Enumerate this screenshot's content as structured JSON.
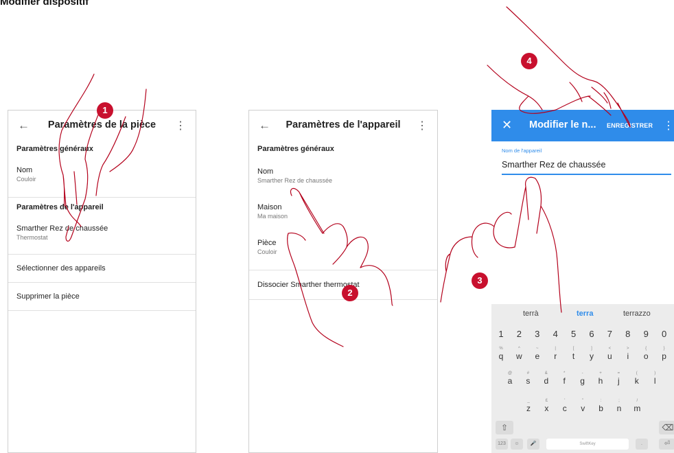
{
  "page": {
    "title": "Modifier dispositif"
  },
  "screen1": {
    "title": "Paramètres de la pièce",
    "back_icon": "←",
    "menu_icon": "⋮",
    "section_general": "Paramètres généraux",
    "name_label": "Nom",
    "name_value": "Couloir",
    "section_device": "Paramètres de l'appareil",
    "device_name": "Smarther Rez de chaussée",
    "device_type": "Thermostat",
    "select_devices": "Sélectionner des appareils",
    "delete_room": "Supprimer la pièce"
  },
  "screen2": {
    "title": "Paramètres de l'appareil",
    "back_icon": "←",
    "menu_icon": "⋮",
    "section_general": "Paramètres généraux",
    "name_label": "Nom",
    "name_value": "Smarther Rez de chaussée",
    "home_label": "Maison",
    "home_value": "Ma maison",
    "room_label": "Pièce",
    "room_value": "Couloir",
    "dissociate": "Dissocier Smarther thermostat"
  },
  "screen3": {
    "title": "Modifier le n...",
    "close_icon": "✕",
    "save": "ENREGISTRER",
    "menu_icon": "⋮",
    "field_label": "Nom de l'appareil",
    "field_value": "Smarther Rez de chaussée",
    "keyboard": {
      "suggestions": [
        "terrà",
        "terra",
        "terrazzo"
      ],
      "numbers": [
        "1",
        "2",
        "3",
        "4",
        "5",
        "6",
        "7",
        "8",
        "9",
        "0"
      ],
      "row1": [
        [
          "%",
          "q"
        ],
        [
          "^",
          "w"
        ],
        [
          "~",
          "e"
        ],
        [
          "|",
          "r"
        ],
        [
          "[",
          "t"
        ],
        [
          "]",
          "y"
        ],
        [
          "<",
          "u"
        ],
        [
          ">",
          "i"
        ],
        [
          "{",
          "o"
        ],
        [
          "}",
          "p"
        ]
      ],
      "row2": [
        [
          "@",
          "a"
        ],
        [
          "#",
          "s"
        ],
        [
          "&",
          "d"
        ],
        [
          "*",
          "f"
        ],
        [
          "-",
          "g"
        ],
        [
          "+",
          "h"
        ],
        [
          "=",
          "j"
        ],
        [
          "(",
          "k"
        ],
        [
          ")",
          "l"
        ]
      ],
      "row3": [
        [
          "_",
          "z"
        ],
        [
          "£",
          "x"
        ],
        [
          "'",
          "c"
        ],
        [
          "\"",
          "v"
        ],
        [
          ":",
          "b"
        ],
        [
          ";",
          "n"
        ],
        [
          "/",
          "m"
        ]
      ],
      "shift_icon": "⇧",
      "backspace_icon": "⌫",
      "enter_icon": "⏎",
      "numbers_key": "123",
      "space_label": "SwiftKey"
    }
  },
  "badges": [
    "1",
    "2",
    "3",
    "4"
  ],
  "colors": {
    "accent": "#2f8cea",
    "badge": "#c8102e",
    "hand_outline": "#b3001b"
  }
}
